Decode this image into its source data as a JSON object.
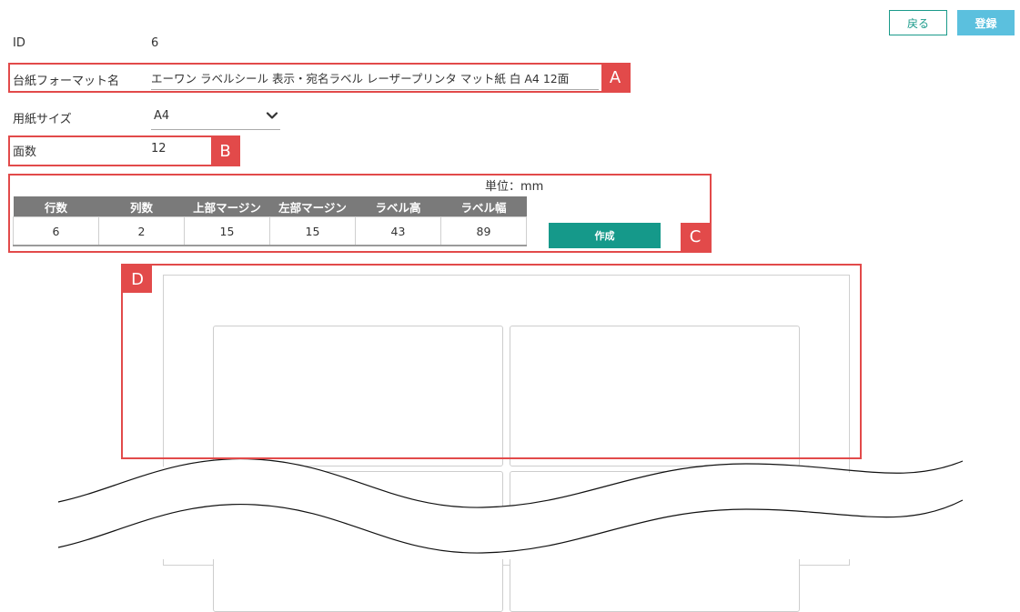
{
  "header": {
    "back_label": "戻る",
    "register_label": "登録"
  },
  "form": {
    "id_label": "ID",
    "id_value": "6",
    "format_name_label": "台紙フォーマット名",
    "format_name_value": "エーワン ラベルシール 表示・宛名ラベル レーザープリンタ マット紙 白 A4 12面",
    "paper_size_label": "用紙サイズ",
    "paper_size_value": "A4",
    "face_count_label": "面数",
    "face_count_value": "12"
  },
  "params": {
    "unit_text": "単位：mm",
    "headers": [
      "行数",
      "列数",
      "上部マージン",
      "左部マージン",
      "ラベル高",
      "ラベル幅"
    ],
    "values": [
      "6",
      "2",
      "15",
      "15",
      "43",
      "89"
    ],
    "create_label": "作成"
  },
  "callouts": {
    "a": "A",
    "b": "B",
    "c": "C",
    "d": "D"
  },
  "colors": {
    "accent_teal": "#15998a",
    "register_blue": "#5bc0de",
    "callout_red": "#e24a4a",
    "table_header_gray": "#7a7a7a"
  },
  "icons": {
    "select_arrow": "chevron-down-icon"
  }
}
